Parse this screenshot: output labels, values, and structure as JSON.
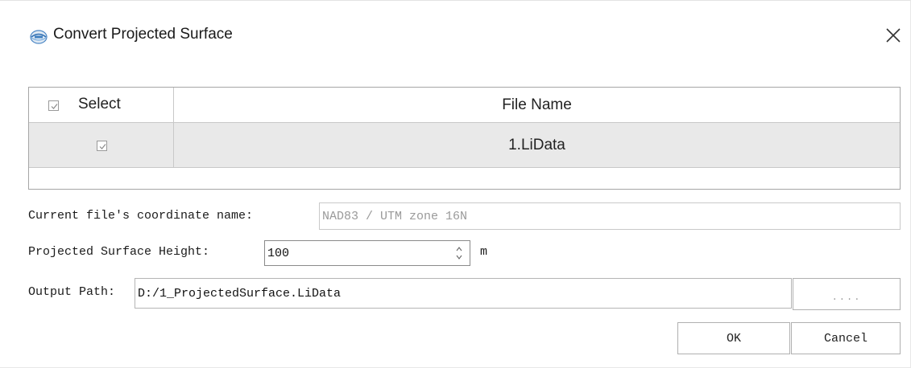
{
  "window": {
    "title": "Convert Projected Surface",
    "app_icon": "app-logo-icon",
    "close_icon": "close-icon"
  },
  "grid": {
    "columns": [
      "Select",
      "File Name"
    ],
    "header_select_checked": true,
    "rows": [
      {
        "checked": true,
        "file_name": "1.LiData"
      }
    ]
  },
  "form": {
    "coordinate_label": "Current file's coordinate name:",
    "coordinate_value": "NAD83 / UTM zone 16N",
    "height_label": "Projected Surface Height:",
    "height_value": "100",
    "height_unit": "m",
    "output_label": "Output Path:",
    "output_value": "D:/1_ProjectedSurface.LiData",
    "browse_label": "...."
  },
  "buttons": {
    "ok": "OK",
    "cancel": "Cancel"
  }
}
